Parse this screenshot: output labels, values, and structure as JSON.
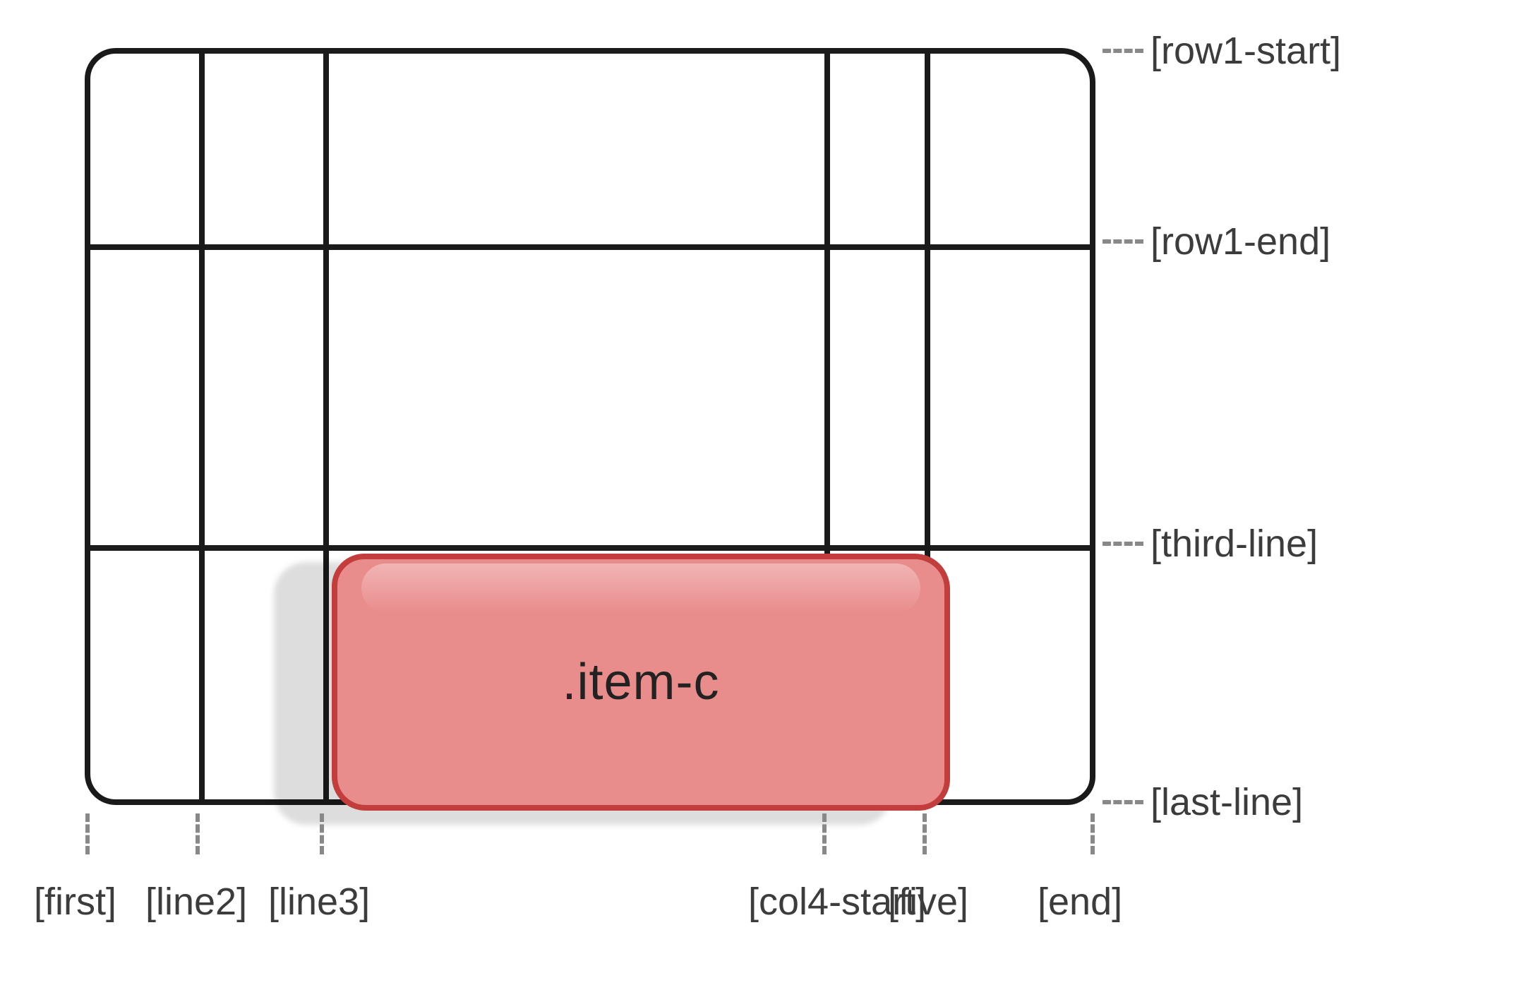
{
  "grid": {
    "column_lines": [
      "[first]",
      "[line2]",
      "[line3]",
      "[col4-start]",
      "[five]",
      "[end]"
    ],
    "row_lines": [
      "[row1-start]",
      "[row1-end]",
      "[third-line]",
      "[last-line]"
    ]
  },
  "item": {
    "label": ".item-c",
    "column_start": "[line3]",
    "column_end": "[five]",
    "row_start": "[third-line]",
    "row_end": "[last-line]",
    "fill_color": "#e98c8c",
    "border_color": "#c33d3d"
  }
}
